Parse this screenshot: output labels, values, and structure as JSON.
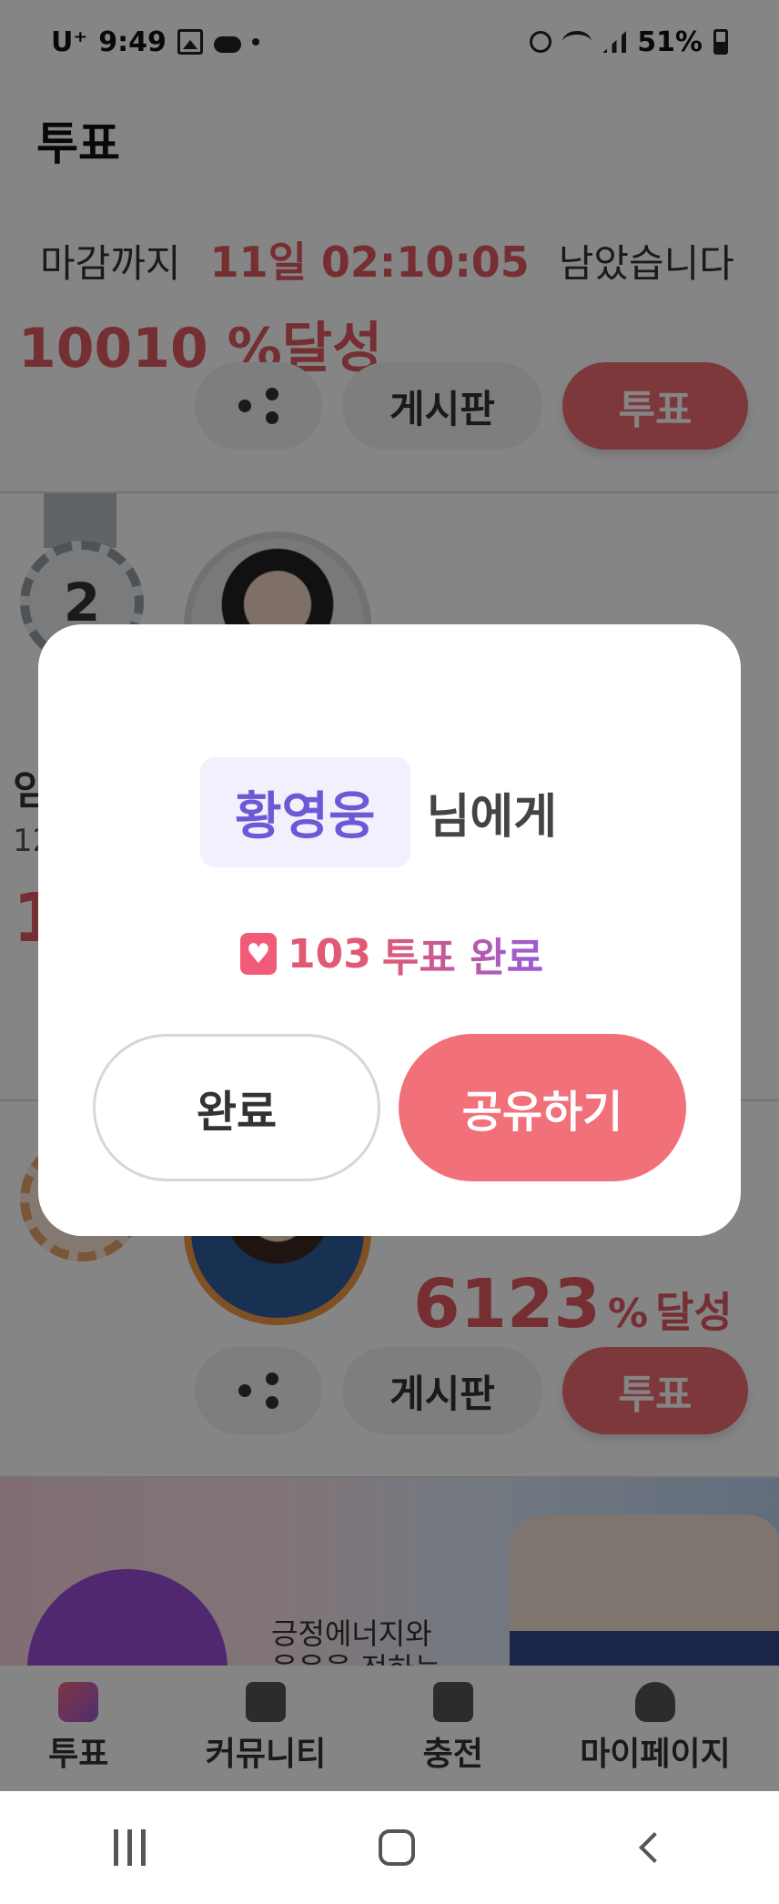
{
  "status_bar": {
    "carrier": "U⁺",
    "time": "9:49",
    "battery": "51%"
  },
  "header": {
    "title": "투표"
  },
  "countdown": {
    "prefix": "마감까지",
    "time": "11일 02:10:05",
    "suffix": "남았습니다"
  },
  "cards": [
    {
      "pct_partial": "10010 %달성",
      "actions": {
        "board": "게시판",
        "vote": "투표"
      }
    },
    {
      "rank": "2",
      "name_partial": "임",
      "sub_partial": "12",
      "pct_partial": "1"
    },
    {
      "pct": "6123",
      "pct_unit": "%",
      "pct_label": "달성",
      "actions": {
        "board": "게시판",
        "vote": "투표"
      }
    }
  ],
  "banner": {
    "text_line1": "긍정에너지와",
    "text_line2": "웃음을 전하는"
  },
  "tabbar": [
    {
      "label": "투표",
      "icon": "heart-ballot-icon"
    },
    {
      "label": "커뮤니티",
      "icon": "chat-bubbles-icon"
    },
    {
      "label": "충전",
      "icon": "shirt-charge-icon"
    },
    {
      "label": "마이페이지",
      "icon": "user-icon"
    }
  ],
  "modal": {
    "recipient": "황영웅",
    "recipient_suffix": "님에게",
    "vote_count": "103",
    "vote_status": "투표 완료",
    "done_label": "완료",
    "share_label": "공유하기"
  },
  "colors": {
    "accent": "#ef6b72",
    "purple": "#6e58d6",
    "overlay": "rgba(0,0,0,0.48)"
  }
}
